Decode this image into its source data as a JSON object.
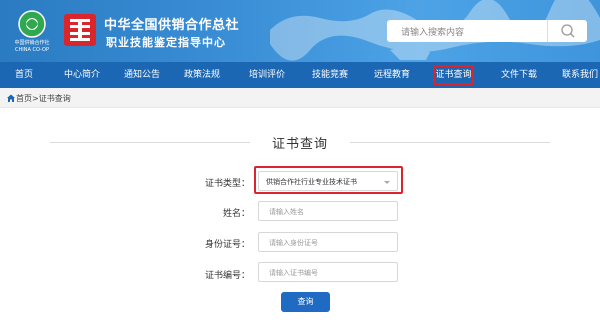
{
  "header": {
    "logo_text": "中国供销合作社",
    "logo_text_en": "CHINA CO-OP",
    "title_main": "中华全国供销合作总社",
    "title_sub": "职业技能鉴定指导中心",
    "search_placeholder": "请输入搜索内容"
  },
  "nav": {
    "items": [
      {
        "label": "首页"
      },
      {
        "label": "中心简介"
      },
      {
        "label": "通知公告"
      },
      {
        "label": "政策法规"
      },
      {
        "label": "培训评价"
      },
      {
        "label": "技能竞赛"
      },
      {
        "label": "远程教育"
      },
      {
        "label": "证书查询",
        "active": true
      },
      {
        "label": "文件下载"
      },
      {
        "label": "联系我们"
      }
    ]
  },
  "breadcrumb": {
    "text": "首页>证书查询"
  },
  "form": {
    "title": "证书查询",
    "cert_type_label": "证书类型：",
    "cert_type_value": "供销合作社行业专业技术证书",
    "name_label": "姓名：",
    "name_placeholder": "请输入姓名",
    "id_label": "身份证号：",
    "id_placeholder": "请输入身份证号",
    "cert_no_label": "证书编号：",
    "cert_no_placeholder": "请输入证书编号",
    "submit_label": "查询"
  },
  "colors": {
    "nav_bg": "#1c67b3",
    "highlight": "#d9262c",
    "button": "#1f6bc4"
  }
}
